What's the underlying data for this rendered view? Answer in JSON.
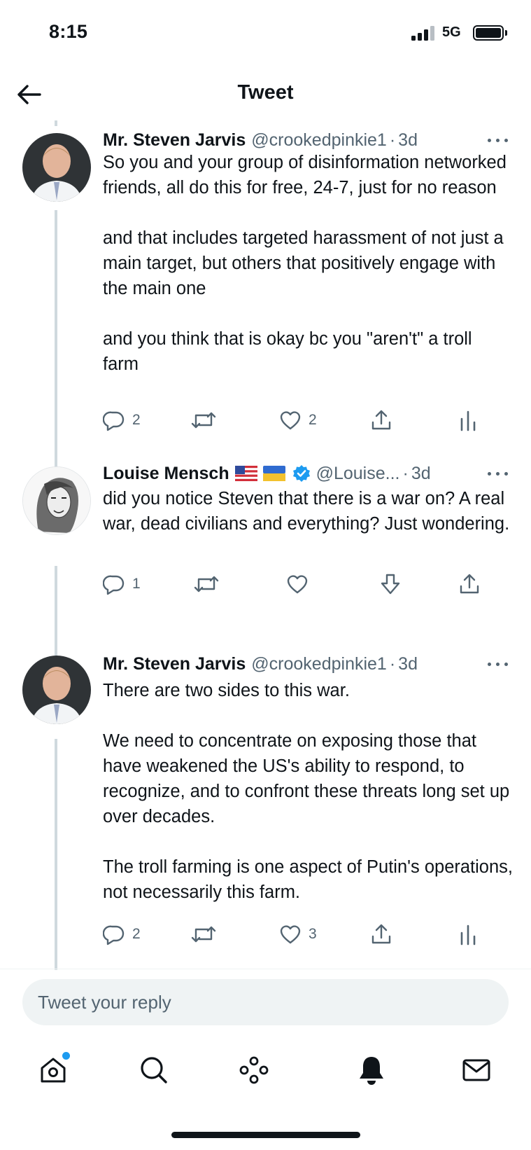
{
  "status_bar": {
    "time": "8:15",
    "network": "5G"
  },
  "header": {
    "title": "Tweet"
  },
  "tweets": [
    {
      "author": "Mr. Steven Jarvis",
      "handle": "@crookedpinkie1",
      "separator": "·",
      "timestamp": "3d",
      "text": "So you and your group of disinformation networked friends, all do this for free, 24-7, just for no reason\n\nand that includes targeted harassment of not just a main target, but others that positively engage with the main one\n\nand you think that is okay bc you \"aren't\" a troll farm",
      "replies": "2",
      "retweets": "",
      "likes": "2"
    },
    {
      "author": "Louise Mensch",
      "flags": [
        "us-flag",
        "ukraine-flag"
      ],
      "verified": true,
      "handle": "@Louise...",
      "separator": "·",
      "timestamp": "3d",
      "text": "did you notice Steven that there is a war on? A real war, dead civilians and everything? Just wondering.",
      "replies": "1",
      "retweets": "",
      "likes": ""
    },
    {
      "author": "Mr. Steven Jarvis",
      "handle": "@crookedpinkie1",
      "separator": "·",
      "timestamp": "3d",
      "text": "There are two sides to this war.\n\nWe need to concentrate on exposing those that have weakened the US's ability to respond, to recognize, and to confront these threats long set up over decades.\n\nThe troll farming is one aspect of Putin's operations, not necessarily this farm.",
      "replies": "2",
      "retweets": "",
      "likes": "3"
    }
  ],
  "reply": {
    "placeholder": "Tweet your reply"
  },
  "tabbar": {
    "items": [
      "home-icon",
      "search-icon",
      "spaces-icon",
      "notifications-bell-icon",
      "messages-envelope-icon"
    ],
    "home_badge": true
  },
  "colors": {
    "text": "#0f1419",
    "secondary": "#536471",
    "accent": "#1d9bf0",
    "thread_line": "#cfd9de",
    "reply_bg": "#eff3f4"
  }
}
